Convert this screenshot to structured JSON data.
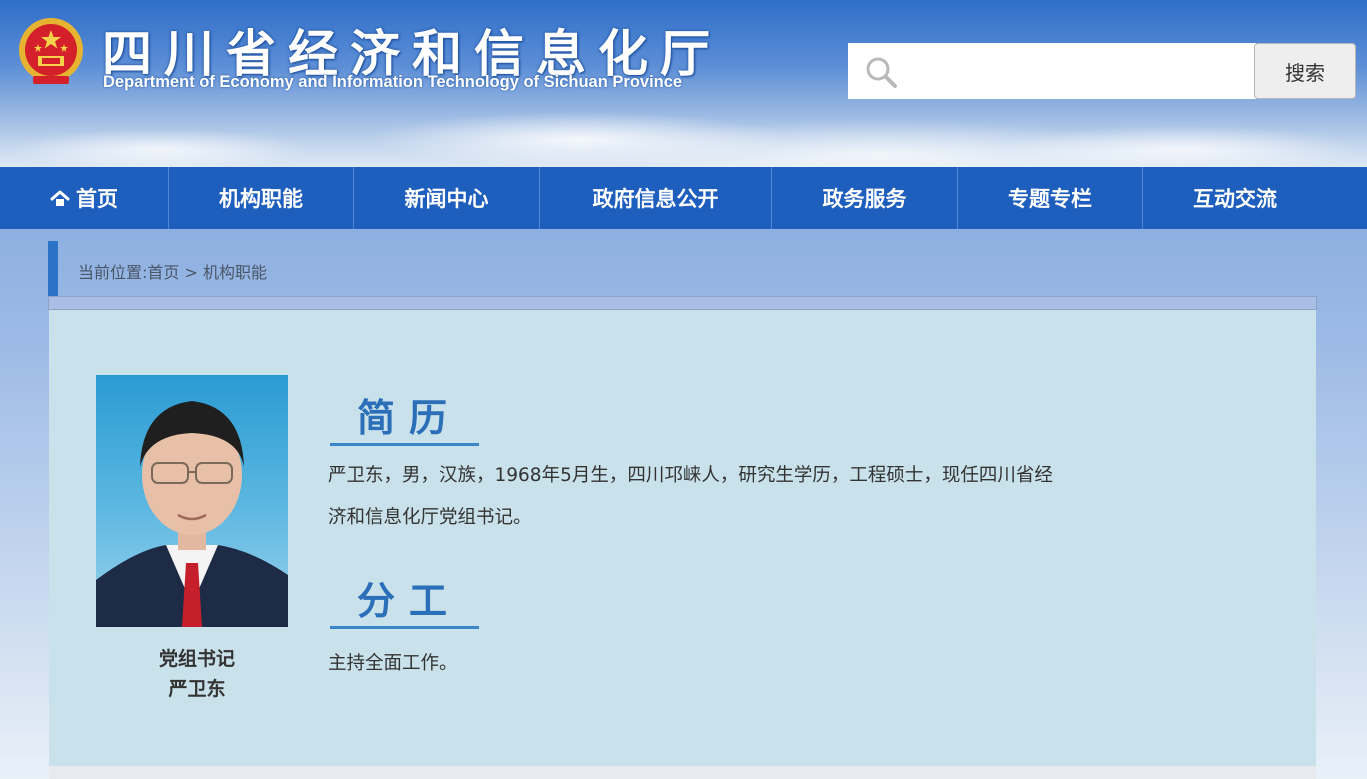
{
  "header": {
    "title_cn": "四川省经济和信息化厅",
    "title_en": "Department of Economy and Information Technology of Sichuan Province",
    "search": {
      "placeholder": "",
      "value": "",
      "button_label": "搜索"
    }
  },
  "nav": {
    "items": [
      {
        "label": "首页",
        "icon": "home-icon"
      },
      {
        "label": "机构职能"
      },
      {
        "label": "新闻中心"
      },
      {
        "label": "政府信息公开"
      },
      {
        "label": "政务服务"
      },
      {
        "label": "专题专栏"
      },
      {
        "label": "互动交流"
      }
    ]
  },
  "breadcrumb": {
    "prefix": "当前位置:",
    "home": "首页",
    "separator": " > ",
    "current": "机构职能"
  },
  "profile": {
    "position": "党组书记",
    "name": "严卫东",
    "resume_heading": "简历",
    "resume_line1": "严卫东，男，汉族，1968年5月生，四川邛崃人，研究生学历，工程硕士，现任四川省经",
    "resume_line2": "济和信息化厅党组书记。",
    "duty_heading": "分工",
    "duty_text": "主持全面工作。"
  },
  "colors": {
    "nav_bg": "#1e5ebd",
    "panel_bg": "#c9e1ea",
    "heading": "#2a6fb8",
    "accent": "#2b73c6"
  }
}
